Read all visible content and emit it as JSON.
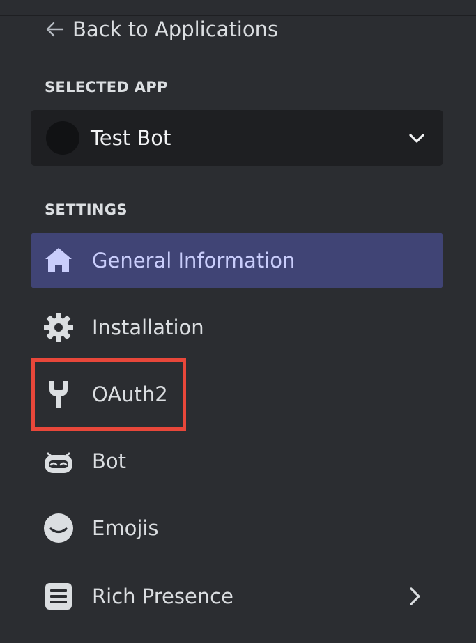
{
  "navigation": {
    "back_label": "Back to Applications"
  },
  "selected_app": {
    "section_title": "SELECTED APP",
    "app_name": "Test Bot"
  },
  "settings": {
    "section_title": "SETTINGS",
    "items": [
      {
        "label": "General Information",
        "icon": "home-icon",
        "active": true
      },
      {
        "label": "Installation",
        "icon": "gear-icon",
        "active": false
      },
      {
        "label": "OAuth2",
        "icon": "wrench-icon",
        "active": false
      },
      {
        "label": "Bot",
        "icon": "robot-icon",
        "active": false
      },
      {
        "label": "Emojis",
        "icon": "smiley-icon",
        "active": false
      },
      {
        "label": "Rich Presence",
        "icon": "document-icon",
        "active": false,
        "has_submenu": true
      }
    ]
  },
  "annotation": {
    "highlighted_item": "OAuth2",
    "highlight_color": "#e8473a"
  },
  "colors": {
    "background": "#2b2d31",
    "active_item_bg": "#404475",
    "select_bg": "#1e1f22"
  }
}
